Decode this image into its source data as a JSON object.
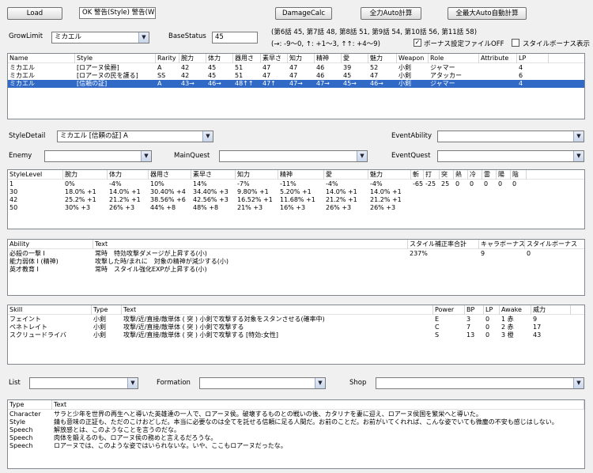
{
  "toolbar": {
    "load": "Load",
    "warning": "OK 警告(Style) 警告(W",
    "damage": "DamageCalc",
    "full_auto": "全力Auto計算",
    "max_auto": "全最大Auto自動計算"
  },
  "top": {
    "growlimit_label": "GrowLimit",
    "growlimit_value": "ミカエル",
    "basestatus_label": "BaseStatus",
    "basestatus_value": "45",
    "chapter_info": "(第6話 45, 第7話 48, 第8話 51, 第9話 54, 第10話 56, 第11話 58)",
    "arrow_info": "(→: -9〜0, ↑: +1〜3, ↑↑: +4〜9)",
    "bonus_file_label": "ボーナス設定ファイルOFF",
    "style_bonus_label": "スタイルボーナス表示"
  },
  "chars": {
    "headers": [
      "Name",
      "Style",
      "Rarity",
      "腕力",
      "体力",
      "器用さ",
      "素早さ",
      "知力",
      "精神",
      "愛",
      "魅力",
      "Weapon",
      "Role",
      "Attribute",
      "LP"
    ],
    "rows": [
      [
        "ミカエル",
        "[ロアーヌ侯爵]",
        "A",
        "42",
        "45",
        "51",
        "47",
        "47",
        "46",
        "39",
        "52",
        "小剣",
        "ジャマー",
        "",
        "4"
      ],
      [
        "ミカエル",
        "[ロアーヌの民を護る]",
        "SS",
        "42",
        "45",
        "51",
        "47",
        "47",
        "46",
        "45",
        "47",
        "小剣",
        "アタッカー",
        "",
        "6"
      ],
      [
        "ミカエル",
        "[信頼の証]",
        "A",
        "43→",
        "46→",
        "48↑↑",
        "47↑",
        "47→",
        "47→",
        "45→",
        "46→",
        "小剣",
        "ジャマー",
        "",
        "4"
      ]
    ]
  },
  "style_detail": {
    "label": "StyleDetail",
    "value": "ミカエル [信頼の証] A",
    "event_ability_label": "EventAbility",
    "enemy_label": "Enemy",
    "mainquest_label": "MainQuest",
    "eventquest_label": "EventQuest"
  },
  "levels": {
    "headers": [
      "StyleLevel",
      "腕力",
      "体力",
      "器用さ",
      "素早さ",
      "知力",
      "精神",
      "愛",
      "魅力",
      "斬",
      "打",
      "突",
      "熱",
      "冷",
      "雷",
      "陽",
      "陰"
    ],
    "rows": [
      [
        "1",
        "0%",
        "-4%",
        "10%",
        "14%",
        "-7%",
        "-11%",
        "-4%",
        "-4%",
        "-65",
        "-25",
        "25",
        "0",
        "0",
        "0",
        "0",
        "0"
      ],
      [
        "30",
        "18.0% +1",
        "14.0% +1",
        "30.40% +4",
        "34.40% +3",
        "9.80% +1",
        "5.20% +1",
        "14.0% +1",
        "14.0% +1",
        "",
        "",
        "",
        "",
        "",
        "",
        "",
        ""
      ],
      [
        "42",
        "25.2% +1",
        "21.2% +1",
        "38.56% +6",
        "42.56% +3",
        "16.52% +1",
        "11.68% +1",
        "21.2% +1",
        "21.2% +1",
        "",
        "",
        "",
        "",
        "",
        "",
        "",
        ""
      ],
      [
        "50",
        "30% +3",
        "26% +3",
        "44% +8",
        "48% +8",
        "21% +3",
        "16% +3",
        "26% +3",
        "26% +3",
        "",
        "",
        "",
        "",
        "",
        "",
        "",
        ""
      ]
    ]
  },
  "abilities": {
    "headers": [
      "Ability",
      "Text",
      "スタイル補正率合計",
      "キャラボーナス",
      "スタイルボーナス"
    ],
    "rows": [
      [
        "必殺の一撃 I",
        "常時　特効攻撃ダメージが上昇する(小)",
        "237%",
        "9",
        "0"
      ],
      [
        "能力弱体 I (精神)",
        "攻撃した時/まれに　対象の精神が減少する(小)",
        "",
        "",
        ""
      ],
      [
        "英才教育 I",
        "常時　スタイル強化EXPが上昇する(小)",
        "",
        "",
        ""
      ]
    ]
  },
  "skills": {
    "headers": [
      "Skill",
      "Type",
      "Text",
      "Power",
      "BP",
      "LP",
      "Awake",
      "威力"
    ],
    "rows": [
      [
        "フェイント",
        "小剣",
        "攻撃/近/直接/敵単体 ( 突 ) 小剣で攻撃する対象をスタンさせる(確率中)",
        "E",
        "3",
        "0",
        "1 赤",
        "9"
      ],
      [
        "ペネトレイト",
        "小剣",
        "攻撃/近/直接/敵単体 ( 突 ) 小剣で攻撃する",
        "C",
        "7",
        "0",
        "2 赤",
        "17"
      ],
      [
        "スクリュードライバ",
        "小剣",
        "攻撃/近/直接/敵単体 ( 突 ) 小剣で攻撃する [特効:女性]",
        "S",
        "13",
        "0",
        "3 橙",
        "43"
      ]
    ]
  },
  "bottom": {
    "list_label": "List",
    "formation_label": "Formation",
    "shop_label": "Shop"
  },
  "texts": {
    "headers": [
      "Type",
      "Text"
    ],
    "rows": [
      [
        "Character",
        "サラと少年を世界の再生へと導いた英雄達の一人で、ロアーヌ侯。破壊するものとの戦いの後、カタリナを妻に迎え、ロアーヌ侯国を繁栄へと導いた。"
      ],
      [
        "Style",
        "錆も意味の正証も、ただのこけおどしだ。本当に必要なのは全てを託せる信頼に足る人間だ。お前のことだ。お前がいてくれれば、こんな姿でいても微塵の不安も感じはしない。"
      ],
      [
        "Speech",
        "解放感とは、このようなことを言うのだな。"
      ],
      [
        "Speech",
        "肉体を鍛えるのも、ロアーヌ侯の務めと言えるだろうな。"
      ],
      [
        "Speech",
        "ロアーヌでは、このような姿ではいられないな。いや、ここもロアーヌだったな。"
      ]
    ]
  }
}
